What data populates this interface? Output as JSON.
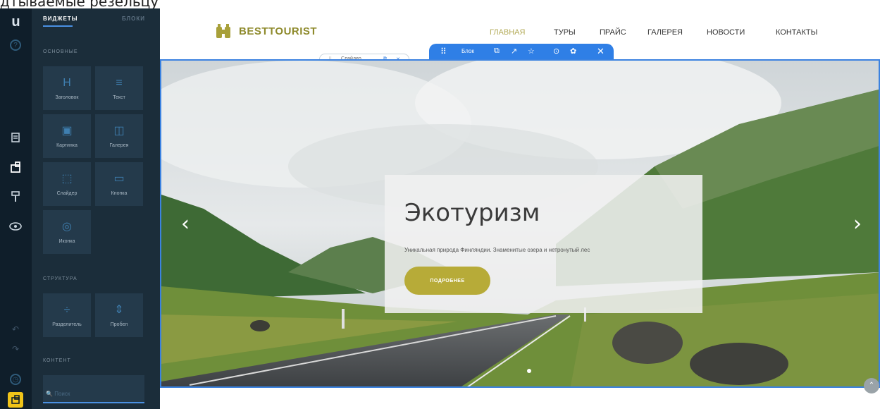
{
  "caption": "дтываемые резельцу",
  "rail": {
    "logo": "u",
    "icons": [
      "help-icon",
      "pages-icon",
      "widgets-icon",
      "paint-icon",
      "eye-icon",
      "undo-icon",
      "redo-icon",
      "history-icon",
      "publish-icon"
    ]
  },
  "panel": {
    "tabs": {
      "widgets": "ВИДЖЕТЫ",
      "blocks": "БЛОКИ"
    },
    "sections": {
      "basic": "ОСНОВНЫЕ",
      "structure": "СТРУКТУРА",
      "content": "КОНТЕНТ"
    },
    "tiles": [
      {
        "label": "Заголовок",
        "glyph": "H"
      },
      {
        "label": "Текст",
        "glyph": "≡"
      },
      {
        "label": "Картинка",
        "glyph": "▣"
      },
      {
        "label": "Галерея",
        "glyph": "◫"
      },
      {
        "label": "Слайдер",
        "glyph": "⬚"
      },
      {
        "label": "Кнопка",
        "glyph": "▭"
      },
      {
        "label": "Иконка",
        "glyph": "◎"
      },
      {
        "label": "Разделитель",
        "glyph": "÷"
      },
      {
        "label": "Пробел",
        "glyph": "⇕"
      }
    ],
    "search_placeholder": "Поиск"
  },
  "site": {
    "logo_text": "BESTTOURIST",
    "nav": [
      "ГЛАВНАЯ",
      "ТУРЫ",
      "ПРАЙС",
      "ГАЛЕРЕЯ",
      "НОВОСТИ",
      "КОНТАКТЫ"
    ],
    "nav_active": "ГЛАВНАЯ"
  },
  "block_toolbar": {
    "label": "Блок",
    "actions": [
      "copy-icon",
      "move-icon",
      "star-icon",
      "settings-icon",
      "gear-icon",
      "close-icon"
    ]
  },
  "slider_pill": {
    "label": "Слайдер"
  },
  "hero": {
    "title": "Экотуризм",
    "text": "Уникальная природа Финляндии. Знаменитые озера и нетронутый лес",
    "button": "ПОДРОБНЕЕ"
  },
  "colors": {
    "rail_bg": "#0f1e2a",
    "panel_bg": "#1b2d3a",
    "accent_blue": "#2f7fe6",
    "brand_olive": "#b7ab38",
    "nav_active": "#b3ab58"
  }
}
